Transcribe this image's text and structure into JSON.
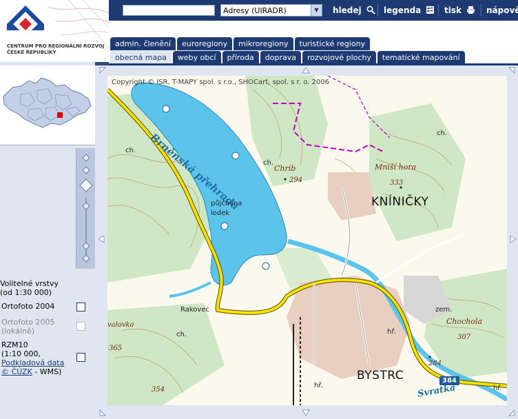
{
  "brand": {
    "org_line1": "CENTRUM PRO REGIONÁLNÍ ROZVOJ",
    "org_line2": "ČESKÉ REPUBLIKY",
    "logo_colors": {
      "blue": "#1e4aa0",
      "red": "#d7262c"
    }
  },
  "toolbar": {
    "search_value": "",
    "search_select": "Adresy (UIRADR)",
    "search_label": "hledej",
    "legend_label": "legenda",
    "print_label": "tisk",
    "help_label": "nápověda",
    "icons": {
      "search": "magnifier-icon",
      "legend": "legend-icon",
      "print": "printer-icon"
    }
  },
  "tabs": {
    "row1": [
      "admin. členění",
      "euroregiony",
      "mikroregiony",
      "turistické regiony"
    ],
    "row2": [
      "obecná mapa",
      "weby obcí",
      "příroda",
      "doprava",
      "rozvojové plochy",
      "tematické mapování"
    ],
    "active": "obecná mapa"
  },
  "layers": {
    "title_line1": "Volitelné vrstvy",
    "title_line2": "(od 1:30 000)",
    "items": [
      {
        "lines": [
          "Ortofoto 2004"
        ],
        "enabled": true,
        "checked": false
      },
      {
        "lines": [
          "Ortofoto 2005",
          "(lokálně)"
        ],
        "enabled": false,
        "checked": false
      },
      {
        "lines": [
          "RZM10",
          "(1:10 000,"
        ],
        "link": "Podkladová data",
        "link2": "© ČÚZK",
        "suffix": " - WMS)",
        "enabled": true,
        "checked": false
      }
    ]
  },
  "map": {
    "copyright": "Copyright © ISR, T-MAPY spol. s r.o., SHOCart, spol. s r. o. 2006",
    "labels": {
      "reservoir": "Brněnská přehrada",
      "village1": "KNÍNIČKY",
      "village2": "BYSTRC",
      "river": "Svratka",
      "hill1": "Chrib",
      "hill1_elev": "294",
      "hill2": "Mniší hora",
      "hill2_elev": "333",
      "hill3": "Chochola",
      "hill3_elev": "307",
      "elev_a": "284",
      "elev_b": "365",
      "elev_c": "354",
      "rakovec": "Rakovec",
      "boat1": "půjčovna",
      "boat2": "lodek",
      "ch1": "ch.",
      "ch2": "ch.",
      "ch3": "ch.",
      "ch4": "ch.",
      "zem": "zem.",
      "hr1": "hř.",
      "hr2": "hř.",
      "hr3": "hř.",
      "valovka": "valovka",
      "road": "384"
    },
    "colors": {
      "water": "#5cc3ea",
      "forest": "#cfe7c4",
      "built": "#e8cfc0",
      "road": "#f7e200",
      "contour": "#b98a5a",
      "boundary": "#c000c0"
    }
  }
}
